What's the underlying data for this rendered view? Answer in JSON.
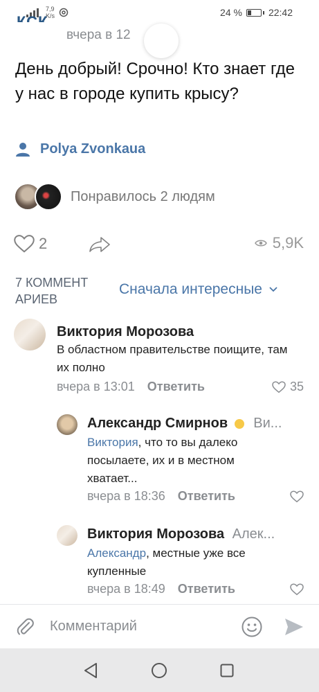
{
  "status": {
    "net_speed": "7,9",
    "net_unit": "K/s",
    "battery": "24 %",
    "time": "22:42"
  },
  "post": {
    "author_cut": "КСК",
    "time": "вчера в 12",
    "text": "День добрый! Срочно! Кто знает где у нас в городе купить крысу?",
    "signature": "Polya Zvonkaua",
    "likes_text": "Понравилось 2 людям",
    "likes_count": "2",
    "views": "5,9K"
  },
  "comments_header": {
    "count_label": "7 КОММЕНТ АРИЕВ",
    "sort_label": "Сначала интересные"
  },
  "comments": [
    {
      "name": "Виктория Морозова",
      "reply_to": "",
      "mention": "",
      "text": "В областном правительстве поищите, там их полно",
      "time": "вчера в 13:01",
      "reply": "Ответить",
      "likes": "35"
    },
    {
      "name": "Александр Смирнов",
      "reply_to": "Ви...",
      "mention": "Виктория",
      "text": ", что то вы далеко посылаете, их и в местном хватает...",
      "time": "вчера в 18:36",
      "reply": "Ответить",
      "likes": ""
    },
    {
      "name": "Виктория Морозова",
      "reply_to": "Алек...",
      "mention": "Александр",
      "text": ", местные уже все купленные",
      "time": "вчера в 18:49",
      "reply": "Ответить",
      "likes": ""
    }
  ],
  "composer": {
    "placeholder": "Комментарий"
  },
  "colors": {
    "accent": "#4a76a8",
    "muted": "#8a8d91"
  }
}
